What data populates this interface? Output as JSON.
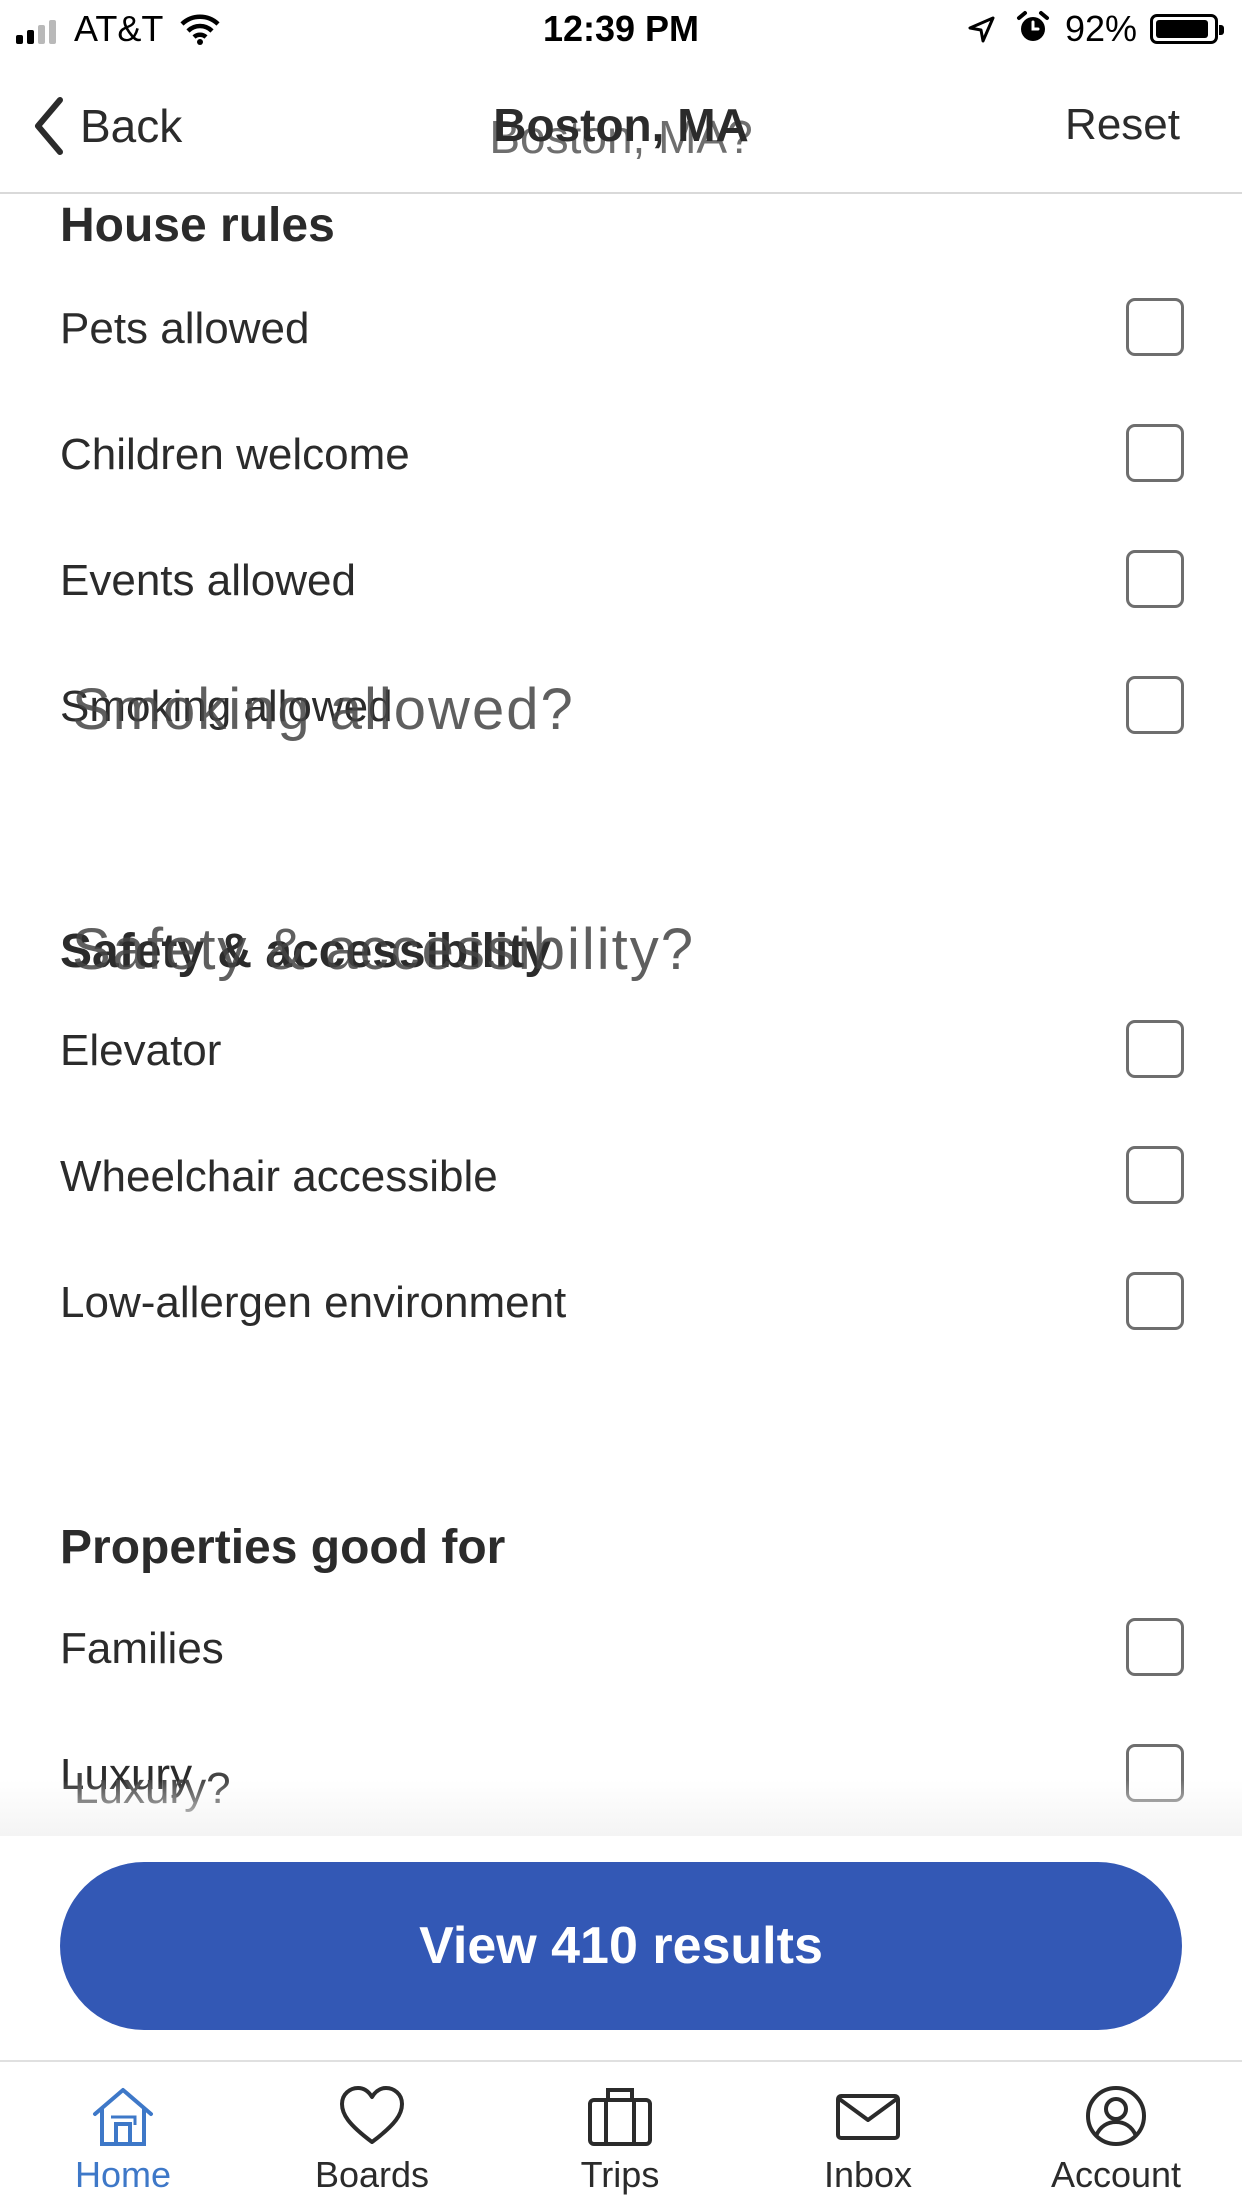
{
  "status_bar": {
    "carrier": "AT&T",
    "time": "12:39 PM",
    "battery_pct": "92%",
    "battery_level": 0.92
  },
  "nav": {
    "back_label": "Back",
    "title": "Boston,  MA",
    "title_ghost": "Boston, MA?",
    "reset_label": "Reset"
  },
  "sections": {
    "house_rules": {
      "heading": "House rules",
      "items": [
        "Pets allowed",
        "Children welcome",
        "Events allowed",
        "Smoking allowed"
      ],
      "ghost_item": "Smoking allowed?"
    },
    "safety": {
      "heading": "Safety & accessibility",
      "ghost_heading": "Safety & accessibility?",
      "items": [
        "Elevator",
        "Wheelchair accessible",
        "Low-allergen environment"
      ]
    },
    "good_for": {
      "heading": "Properties good for",
      "items": [
        "Families",
        "Luxury"
      ],
      "ghost_item": "Luxury?"
    }
  },
  "cta": {
    "label": "View 410 results"
  },
  "tabs": {
    "items": [
      "Home",
      "Boards",
      "Trips",
      "Inbox",
      "Account"
    ],
    "active": "Home"
  },
  "colors": {
    "accent": "#3358b5",
    "active_tab": "#3e78c8",
    "text": "#2b2b2b",
    "checkbox_border": "#6e6e6e"
  }
}
